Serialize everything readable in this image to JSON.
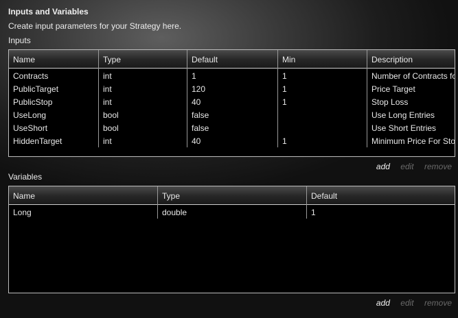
{
  "panel": {
    "title": "Inputs and Variables",
    "subtitle": "Create input parameters for your Strategy here."
  },
  "inputs": {
    "label": "Inputs",
    "columns": [
      "Name",
      "Type",
      "Default",
      "Min",
      "Description"
    ],
    "rows": [
      [
        "Contracts",
        "int",
        "1",
        "1",
        "Number of Contracts for"
      ],
      [
        "PublicTarget",
        "int",
        "120",
        "1",
        "Price Target"
      ],
      [
        "PublicStop",
        "int",
        "40",
        "1",
        "Stop Loss"
      ],
      [
        "UseLong",
        "bool",
        "false",
        "",
        "Use Long Entries"
      ],
      [
        "UseShort",
        "bool",
        "false",
        "",
        "Use Short Entries"
      ],
      [
        "HiddenTarget",
        "int",
        "40",
        "1",
        "Minimum Price For Stop"
      ]
    ],
    "actions": {
      "add": "add",
      "edit": "edit",
      "remove": "remove"
    }
  },
  "variables": {
    "label": "Variables",
    "columns": [
      "Name",
      "Type",
      "Default"
    ],
    "rows": [
      [
        "Long",
        "double",
        "1"
      ]
    ],
    "actions": {
      "add": "add",
      "edit": "edit",
      "remove": "remove"
    }
  }
}
